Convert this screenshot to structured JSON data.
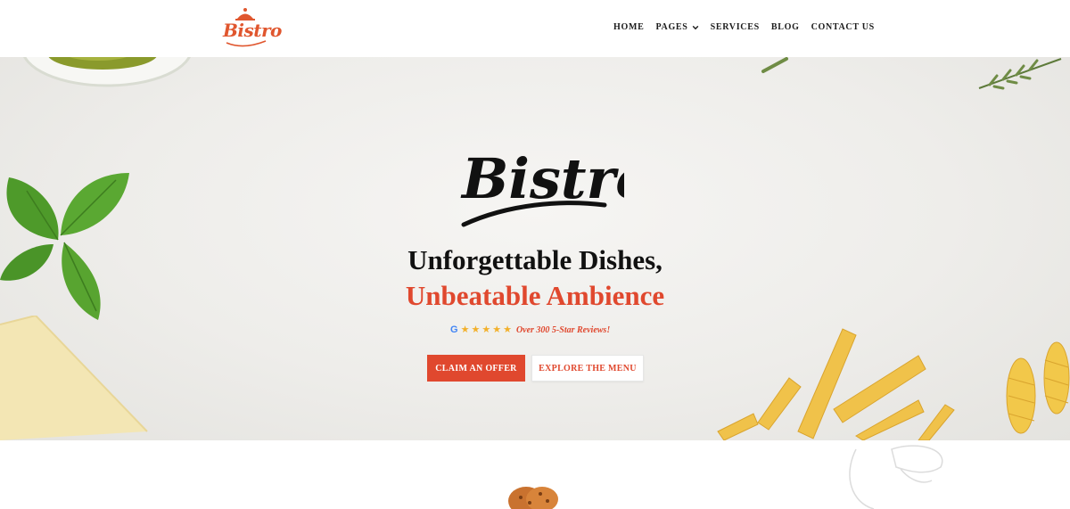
{
  "brand": {
    "logo_text": "Bistro"
  },
  "nav": {
    "items": [
      {
        "label": "HOME"
      },
      {
        "label": "PAGES",
        "has_dropdown": true
      },
      {
        "label": "SERVICES"
      },
      {
        "label": "BLOG"
      },
      {
        "label": "CONTACT US"
      }
    ]
  },
  "hero": {
    "logo_text": "Bistro",
    "headline_line1": "Unforgettable Dishes,",
    "headline_line2": "Unbeatable Ambience",
    "reviews": {
      "google_icon": "G",
      "rating_stars": 5,
      "text": "Over 300 5-Star Reviews!"
    },
    "primary_button": "CLAIM AN OFFER",
    "secondary_button": "EXPLORE THE MENU"
  },
  "colors": {
    "accent": "#e0482e",
    "star": "#f2b02a",
    "text_dark": "#111111"
  },
  "icons": [
    "cloche-icon",
    "chevron-down-icon",
    "google-icon",
    "star-icon",
    "cookie-icon",
    "chef-hat-icon"
  ]
}
